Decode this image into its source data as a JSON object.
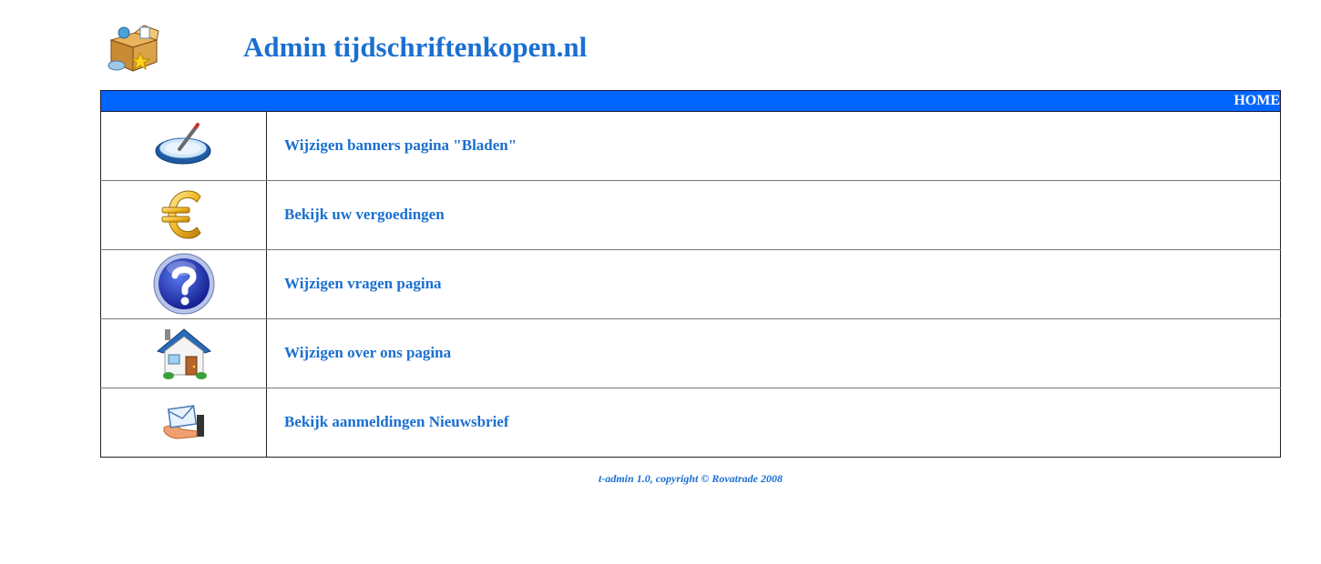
{
  "header": {
    "title": "Admin tijdschriftenkopen.nl",
    "logo_icon": "box-star-icon"
  },
  "topbar": {
    "home_label": "HOME",
    "color": "#0066ff"
  },
  "menu": {
    "items": [
      {
        "icon": "tablet-pen-icon",
        "label": "Wijzigen banners pagina \"Bladen\""
      },
      {
        "icon": "euro-icon",
        "label": "Bekijk uw vergoedingen"
      },
      {
        "icon": "question-icon",
        "label": "Wijzigen vragen pagina"
      },
      {
        "icon": "house-icon",
        "label": "Wijzigen over ons pagina"
      },
      {
        "icon": "envelope-hand-icon",
        "label": "Bekijk aanmeldingen Nieuwsbrief"
      }
    ]
  },
  "footer": {
    "text": "t-admin 1.0, copyright © Rovatrade 2008"
  },
  "colors": {
    "link": "#1a6fd1",
    "bar": "#0066ff"
  }
}
